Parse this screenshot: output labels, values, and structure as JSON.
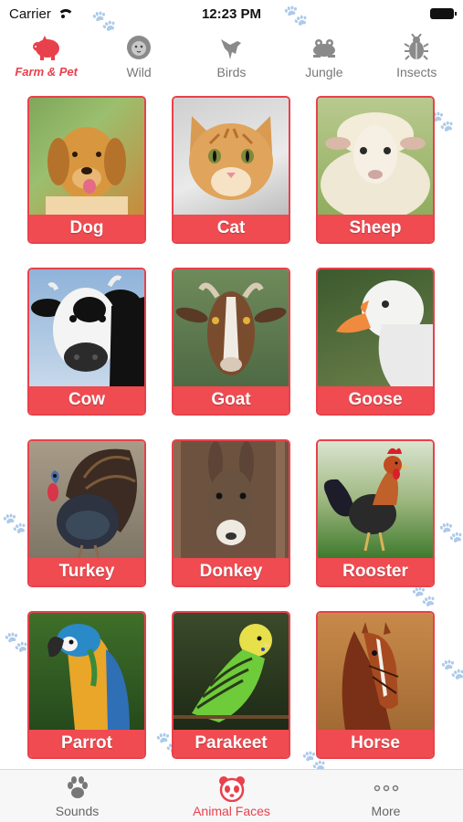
{
  "status_bar": {
    "carrier": "Carrier",
    "time": "12:23 PM"
  },
  "categories": [
    {
      "label": "Farm & Pet",
      "icon": "pig-icon",
      "active": true
    },
    {
      "label": "Wild",
      "icon": "lion-icon",
      "active": false
    },
    {
      "label": "Birds",
      "icon": "bird-icon",
      "active": false
    },
    {
      "label": "Jungle",
      "icon": "frog-icon",
      "active": false
    },
    {
      "label": "Insects",
      "icon": "beetle-icon",
      "active": false
    }
  ],
  "animals": [
    {
      "name": "Dog",
      "icon": "dog-photo"
    },
    {
      "name": "Cat",
      "icon": "cat-photo"
    },
    {
      "name": "Sheep",
      "icon": "sheep-photo"
    },
    {
      "name": "Cow",
      "icon": "cow-photo"
    },
    {
      "name": "Goat",
      "icon": "goat-photo"
    },
    {
      "name": "Goose",
      "icon": "goose-photo"
    },
    {
      "name": "Turkey",
      "icon": "turkey-photo"
    },
    {
      "name": "Donkey",
      "icon": "donkey-photo"
    },
    {
      "name": "Rooster",
      "icon": "rooster-photo"
    },
    {
      "name": "Parrot",
      "icon": "parrot-photo"
    },
    {
      "name": "Parakeet",
      "icon": "parakeet-photo"
    },
    {
      "name": "Horse",
      "icon": "horse-photo"
    }
  ],
  "tab_bar": [
    {
      "label": "Sounds",
      "icon": "paw-icon",
      "active": false
    },
    {
      "label": "Animal Faces",
      "icon": "panda-face-icon",
      "active": true
    },
    {
      "label": "More",
      "icon": "ellipsis-icon",
      "active": false
    }
  ],
  "colors": {
    "accent": "#e8414c",
    "card_label_bg": "#ef4b51",
    "inactive": "#777777"
  }
}
